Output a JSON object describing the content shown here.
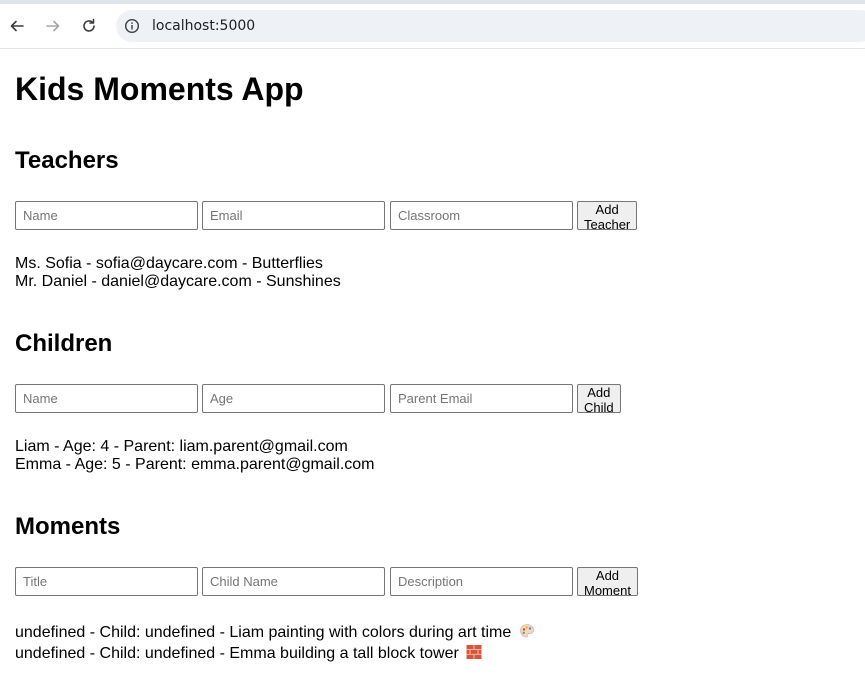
{
  "browser": {
    "url": "localhost:5000"
  },
  "page": {
    "title": "Kids Moments App"
  },
  "teachers": {
    "heading": "Teachers",
    "form": {
      "name_placeholder": "Name",
      "email_placeholder": "Email",
      "classroom_placeholder": "Classroom",
      "submit_label": "Add Teacher"
    },
    "items": [
      "Ms. Sofia - sofia@daycare.com - Butterflies",
      "Mr. Daniel - daniel@daycare.com - Sunshines"
    ]
  },
  "children": {
    "heading": "Children",
    "form": {
      "name_placeholder": "Name",
      "age_placeholder": "Age",
      "parent_email_placeholder": "Parent Email",
      "submit_label": "Add Child"
    },
    "items": [
      "Liam - Age: 4 - Parent: liam.parent@gmail.com",
      "Emma - Age: 5 - Parent: emma.parent@gmail.com"
    ]
  },
  "moments": {
    "heading": "Moments",
    "form": {
      "title_placeholder": "Title",
      "child_name_placeholder": "Child Name",
      "description_placeholder": "Description",
      "submit_label": "Add Moment"
    },
    "items": [
      {
        "text": "undefined - Child: undefined - Liam painting with colors during art time",
        "icon": "palette-icon"
      },
      {
        "text": "undefined - Child: undefined - Emma building a tall block tower",
        "icon": "bricks-icon"
      }
    ]
  }
}
